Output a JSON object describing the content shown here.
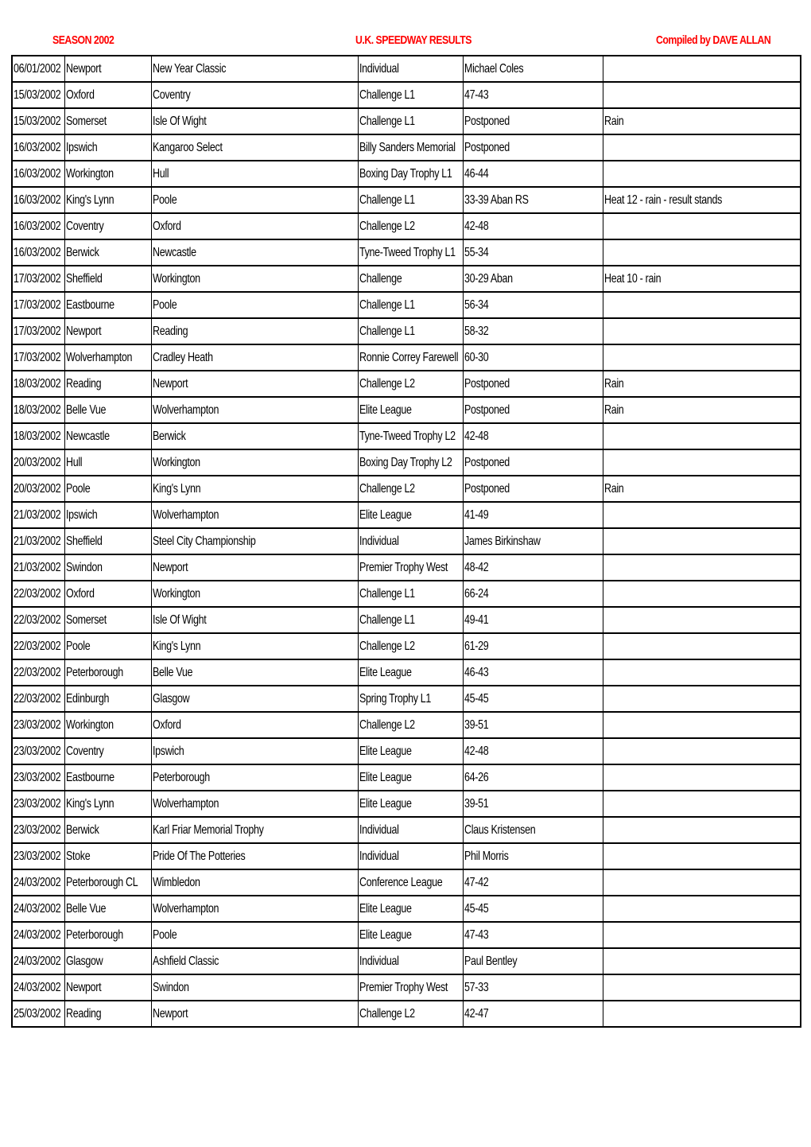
{
  "header": {
    "season": "SEASON 2002",
    "title": "U.K. SPEEDWAY RESULTS",
    "compiled_by": "Compiled by DAVE ALLAN"
  },
  "colors": {
    "header_text": "#ff0000",
    "grid": "#000000",
    "text": "#000000"
  },
  "rows": [
    {
      "date": "06/01/2002",
      "home": "Newport",
      "away": "New Year Classic",
      "competition": "Individual",
      "result": "Michael Coles",
      "note": ""
    },
    {
      "date": "15/03/2002",
      "home": "Oxford",
      "away": "Coventry",
      "competition": "Challenge L1",
      "result": "47-43",
      "note": ""
    },
    {
      "date": "15/03/2002",
      "home": "Somerset",
      "away": "Isle Of Wight",
      "competition": "Challenge L1",
      "result": "Postponed",
      "note": "Rain"
    },
    {
      "date": "16/03/2002",
      "home": "Ipswich",
      "away": "Kangaroo Select",
      "competition": "Billy Sanders Memorial",
      "result": "Postponed",
      "note": ""
    },
    {
      "date": "16/03/2002",
      "home": "Workington",
      "away": "Hull",
      "competition": "Boxing Day Trophy L1",
      "result": "46-44",
      "note": ""
    },
    {
      "date": "16/03/2002",
      "home": "King's Lynn",
      "away": "Poole",
      "competition": "Challenge L1",
      "result": "33-39 Aban RS",
      "note": "Heat 12 - rain - result stands"
    },
    {
      "date": "16/03/2002",
      "home": "Coventry",
      "away": "Oxford",
      "competition": "Challenge L2",
      "result": "42-48",
      "note": ""
    },
    {
      "date": "16/03/2002",
      "home": "Berwick",
      "away": "Newcastle",
      "competition": "Tyne-Tweed Trophy L1",
      "result": "55-34",
      "note": ""
    },
    {
      "date": "17/03/2002",
      "home": "Sheffield",
      "away": "Workington",
      "competition": "Challenge",
      "result": "30-29 Aban",
      "note": "Heat 10 - rain"
    },
    {
      "date": "17/03/2002",
      "home": "Eastbourne",
      "away": "Poole",
      "competition": "Challenge L1",
      "result": "56-34",
      "note": ""
    },
    {
      "date": "17/03/2002",
      "home": "Newport",
      "away": "Reading",
      "competition": "Challenge L1",
      "result": "58-32",
      "note": ""
    },
    {
      "date": "17/03/2002",
      "home": "Wolverhampton",
      "away": "Cradley Heath",
      "competition": "Ronnie Correy Farewell",
      "result": "60-30",
      "note": ""
    },
    {
      "date": "18/03/2002",
      "home": "Reading",
      "away": "Newport",
      "competition": "Challenge L2",
      "result": "Postponed",
      "note": "Rain"
    },
    {
      "date": "18/03/2002",
      "home": "Belle Vue",
      "away": "Wolverhampton",
      "competition": "Elite League",
      "result": "Postponed",
      "note": "Rain"
    },
    {
      "date": "18/03/2002",
      "home": "Newcastle",
      "away": "Berwick",
      "competition": "Tyne-Tweed Trophy L2",
      "result": "42-48",
      "note": ""
    },
    {
      "date": "20/03/2002",
      "home": "Hull",
      "away": "Workington",
      "competition": "Boxing Day Trophy L2",
      "result": "Postponed",
      "note": ""
    },
    {
      "date": "20/03/2002",
      "home": "Poole",
      "away": "King's Lynn",
      "competition": "Challenge L2",
      "result": "Postponed",
      "note": "Rain"
    },
    {
      "date": "21/03/2002",
      "home": "Ipswich",
      "away": "Wolverhampton",
      "competition": "Elite League",
      "result": "41-49",
      "note": ""
    },
    {
      "date": "21/03/2002",
      "home": "Sheffield",
      "away": "Steel City Championship",
      "competition": "Individual",
      "result": "James Birkinshaw",
      "note": ""
    },
    {
      "date": "21/03/2002",
      "home": "Swindon",
      "away": "Newport",
      "competition": "Premier Trophy West",
      "result": "48-42",
      "note": ""
    },
    {
      "date": "22/03/2002",
      "home": "Oxford",
      "away": "Workington",
      "competition": "Challenge L1",
      "result": "66-24",
      "note": ""
    },
    {
      "date": "22/03/2002",
      "home": "Somerset",
      "away": "Isle Of Wight",
      "competition": "Challenge L1",
      "result": "49-41",
      "note": ""
    },
    {
      "date": "22/03/2002",
      "home": "Poole",
      "away": "King's Lynn",
      "competition": "Challenge L2",
      "result": "61-29",
      "note": ""
    },
    {
      "date": "22/03/2002",
      "home": "Peterborough",
      "away": "Belle Vue",
      "competition": "Elite League",
      "result": "46-43",
      "note": ""
    },
    {
      "date": "22/03/2002",
      "home": "Edinburgh",
      "away": "Glasgow",
      "competition": "Spring Trophy L1",
      "result": "45-45",
      "note": ""
    },
    {
      "date": "23/03/2002",
      "home": "Workington",
      "away": "Oxford",
      "competition": "Challenge L2",
      "result": "39-51",
      "note": ""
    },
    {
      "date": "23/03/2002",
      "home": "Coventry",
      "away": "Ipswich",
      "competition": "Elite League",
      "result": "42-48",
      "note": ""
    },
    {
      "date": "23/03/2002",
      "home": "Eastbourne",
      "away": "Peterborough",
      "competition": "Elite League",
      "result": "64-26",
      "note": ""
    },
    {
      "date": "23/03/2002",
      "home": "King's Lynn",
      "away": "Wolverhampton",
      "competition": "Elite League",
      "result": "39-51",
      "note": ""
    },
    {
      "date": "23/03/2002",
      "home": "Berwick",
      "away": "Karl Friar Memorial Trophy",
      "competition": "Individual",
      "result": "Claus Kristensen",
      "note": ""
    },
    {
      "date": "23/03/2002",
      "home": "Stoke",
      "away": "Pride Of The Potteries",
      "competition": "Individual",
      "result": "Phil Morris",
      "note": ""
    },
    {
      "date": "24/03/2002",
      "home": "Peterborough CL",
      "away": "Wimbledon",
      "competition": "Conference League",
      "result": "47-42",
      "note": ""
    },
    {
      "date": "24/03/2002",
      "home": "Belle Vue",
      "away": "Wolverhampton",
      "competition": "Elite League",
      "result": "45-45",
      "note": ""
    },
    {
      "date": "24/03/2002",
      "home": "Peterborough",
      "away": "Poole",
      "competition": "Elite League",
      "result": "47-43",
      "note": ""
    },
    {
      "date": "24/03/2002",
      "home": "Glasgow",
      "away": "Ashfield Classic",
      "competition": "Individual",
      "result": "Paul Bentley",
      "note": ""
    },
    {
      "date": "24/03/2002",
      "home": "Newport",
      "away": "Swindon",
      "competition": "Premier Trophy West",
      "result": "57-33",
      "note": ""
    },
    {
      "date": "25/03/2002",
      "home": "Reading",
      "away": "Newport",
      "competition": "Challenge L2",
      "result": "42-47",
      "note": ""
    }
  ]
}
